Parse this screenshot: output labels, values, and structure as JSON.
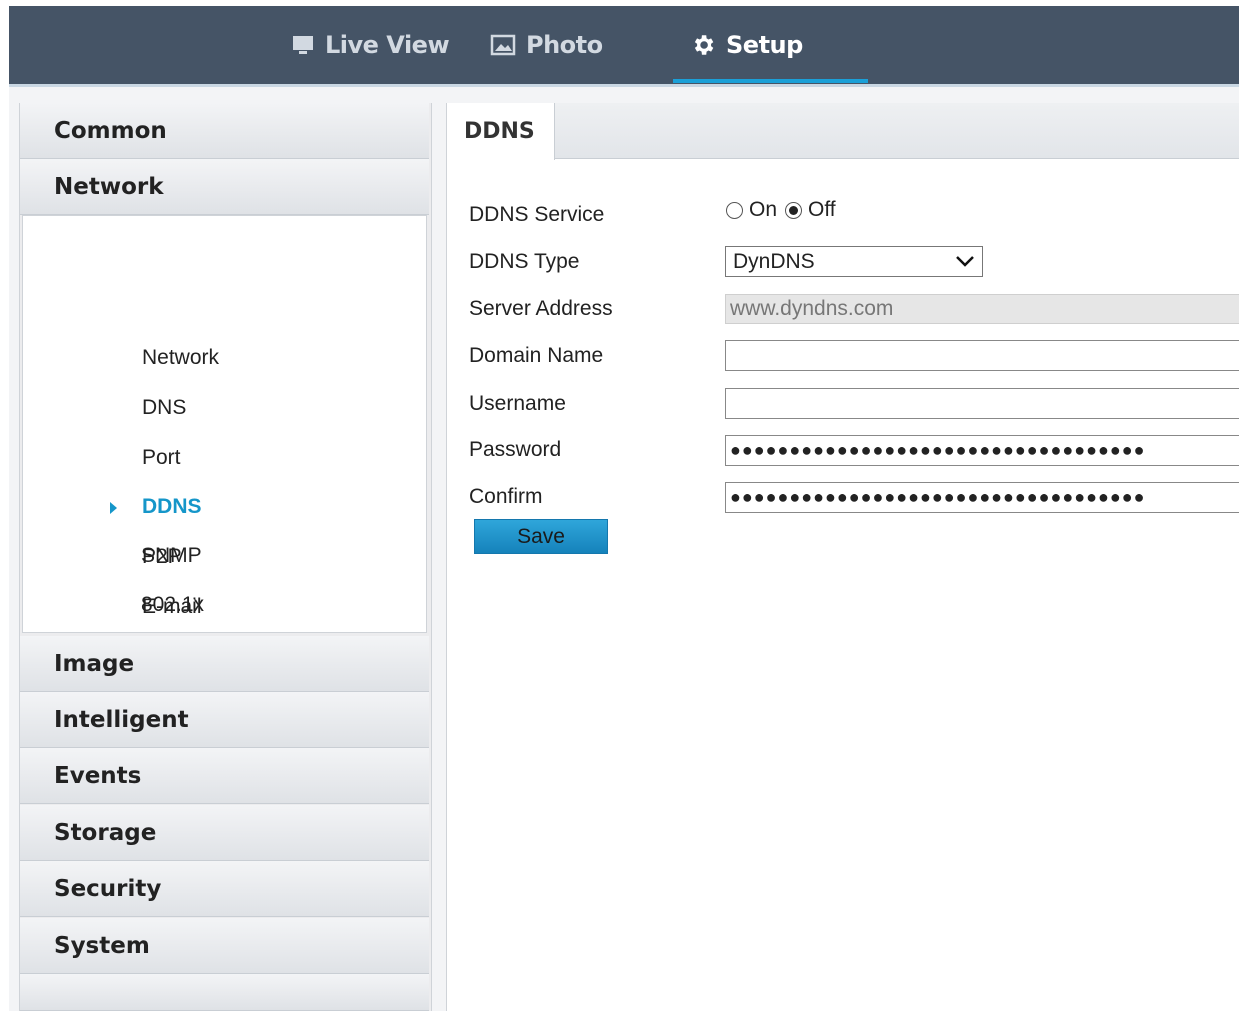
{
  "nav": {
    "tabs": [
      {
        "label": "Live View",
        "icon": "monitor-icon"
      },
      {
        "label": "Photo",
        "icon": "image-icon"
      },
      {
        "label": "Setup",
        "icon": "gear-icon",
        "active": true
      }
    ]
  },
  "sidebar": {
    "categories": [
      "Common",
      "Network",
      "Image",
      "Intelligent",
      "Events",
      "Storage",
      "Security",
      "System"
    ],
    "network_items": [
      "Network",
      "DNS",
      "Port",
      "DDNS",
      "P2P",
      "E-mail",
      "SNMP",
      "802.1x"
    ],
    "active_item": "DDNS"
  },
  "page": {
    "tab": "DDNS",
    "form": {
      "ddns_service_label": "DDNS Service",
      "on_label": "On",
      "off_label": "Off",
      "service_value": "Off",
      "ddns_type_label": "DDNS Type",
      "ddns_type_value": "DynDNS",
      "server_address_label": "Server Address",
      "server_address_value": "www.dyndns.com",
      "domain_name_label": "Domain Name",
      "domain_name_value": "",
      "username_label": "Username",
      "username_value": "",
      "password_label": "Password",
      "password_value": "●●●●●●●●●●●●●●●●●●●●●●●●●●●●●●●●●●●",
      "confirm_label": "Confirm",
      "confirm_value": "●●●●●●●●●●●●●●●●●●●●●●●●●●●●●●●●●●●",
      "save_label": "Save"
    }
  },
  "colors": {
    "topbar": "#455466",
    "accent": "#1aa0d8",
    "active_link": "#1596c9"
  }
}
